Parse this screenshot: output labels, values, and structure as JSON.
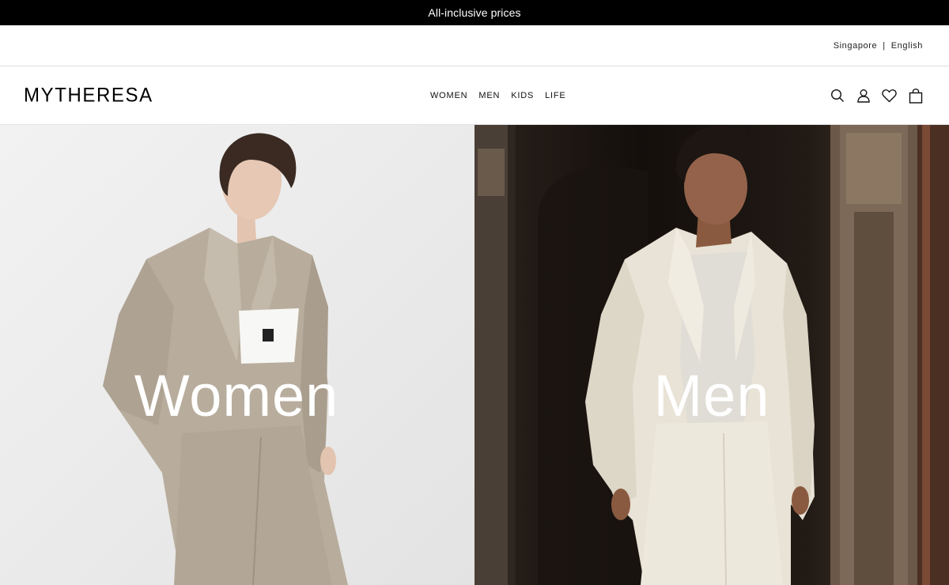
{
  "promo": {
    "text": "All-inclusive prices"
  },
  "locale": {
    "country": "Singapore",
    "separator": "|",
    "language": "English"
  },
  "header": {
    "logo": "MYTHERESA",
    "nav": [
      "WOMEN",
      "MEN",
      "KIDS",
      "LIFE"
    ],
    "icons": [
      "search-icon",
      "account-icon",
      "wishlist-icon",
      "shopping-bag-icon"
    ]
  },
  "hero": {
    "women": {
      "title": "Women"
    },
    "men": {
      "title": "Men"
    }
  },
  "colors": {
    "promo_bg": "#000000",
    "women_bg": "#ececec",
    "men_bg": "#1e1914",
    "suit_women": "#b6ab9c",
    "suit_men": "#e6e0d3"
  }
}
